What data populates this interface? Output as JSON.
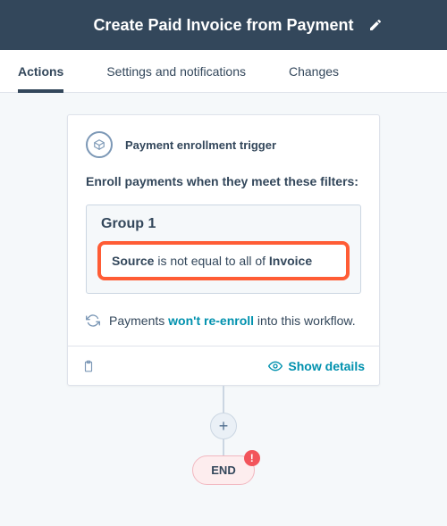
{
  "header": {
    "title": "Create Paid Invoice from Payment"
  },
  "tabs": {
    "actions": "Actions",
    "settings": "Settings and notifications",
    "changes": "Changes"
  },
  "trigger": {
    "label": "Payment enrollment trigger",
    "enroll_text": "Enroll payments when they meet these filters:",
    "group_title": "Group 1",
    "filter": {
      "field": "Source",
      "operator": "is not equal to all of",
      "value": "Invoice"
    },
    "reenroll_prefix": "Payments ",
    "reenroll_link": "won't re-enroll",
    "reenroll_suffix": " into this workflow."
  },
  "footer": {
    "show_details": "Show details"
  },
  "nodes": {
    "end": "END"
  }
}
